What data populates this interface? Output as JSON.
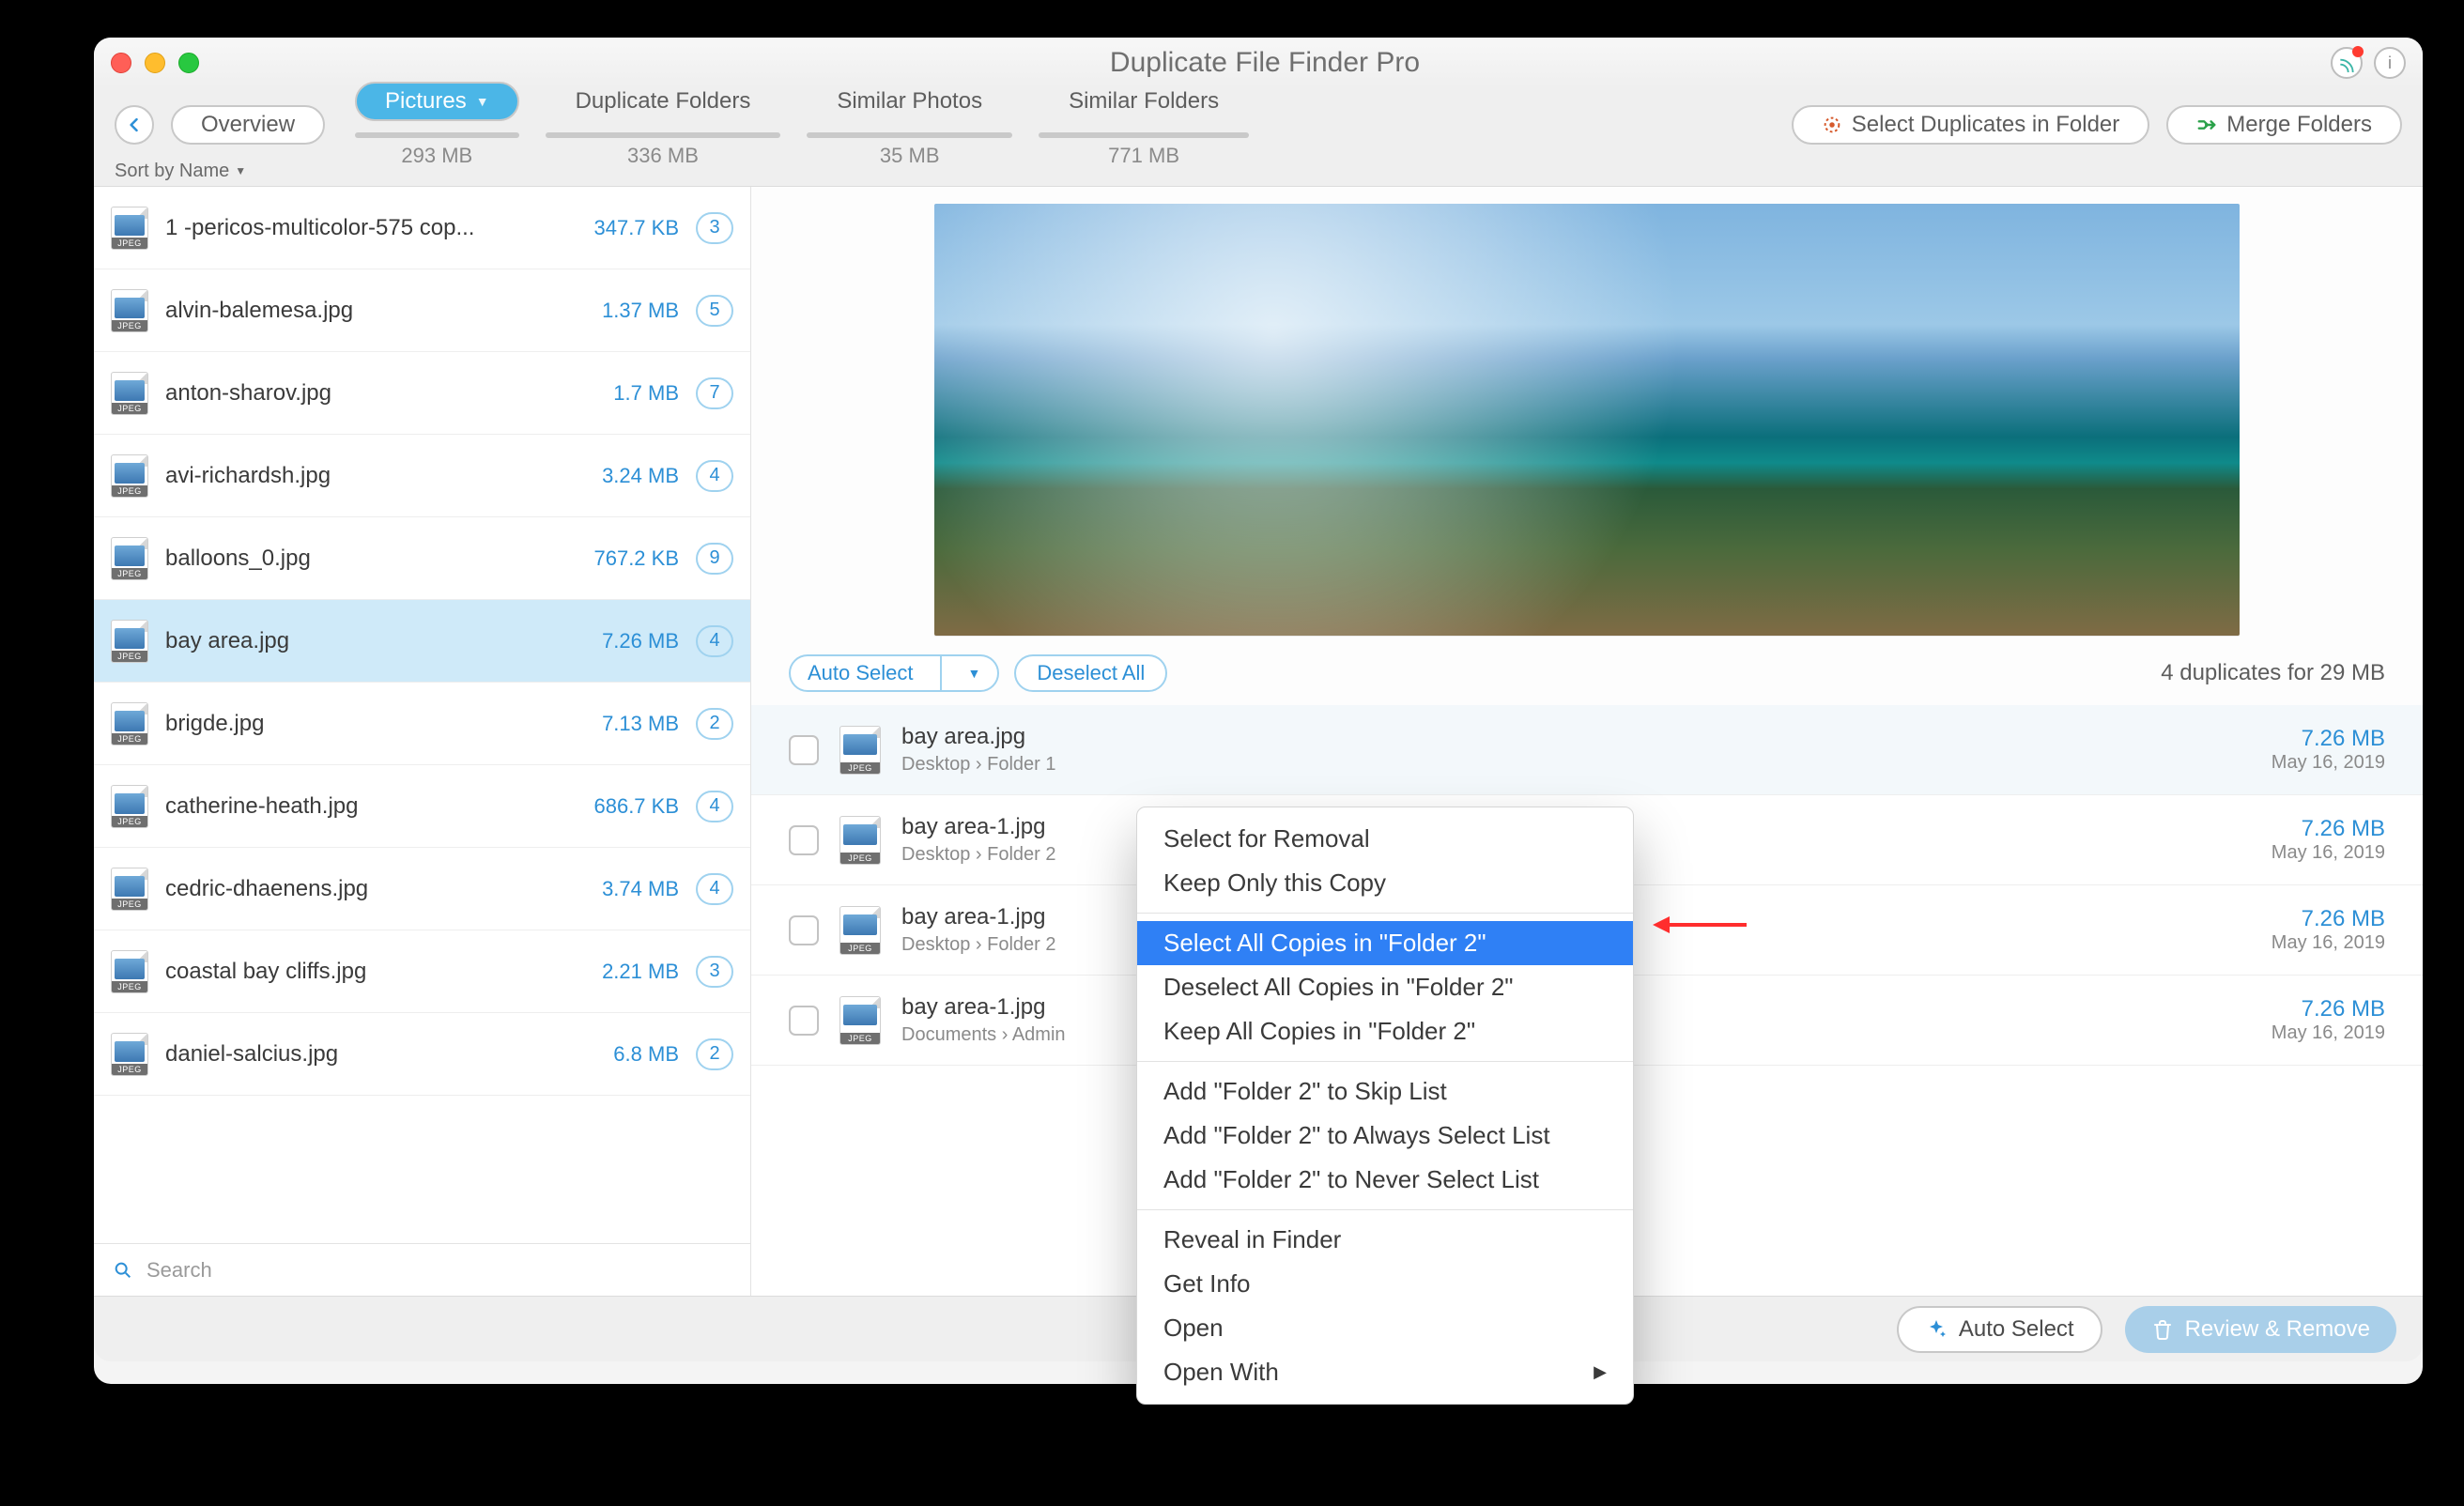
{
  "window": {
    "title": "Duplicate File Finder Pro"
  },
  "toolbar": {
    "overview": "Overview",
    "tabs": [
      {
        "label": "Pictures",
        "size": "293 MB",
        "active": true,
        "has_dropdown": true
      },
      {
        "label": "Duplicate Folders",
        "size": "336 MB"
      },
      {
        "label": "Similar Photos",
        "size": "35 MB"
      },
      {
        "label": "Similar Folders",
        "size": "771 MB"
      }
    ],
    "select_in_folder": "Select Duplicates in Folder",
    "merge_folders": "Merge Folders"
  },
  "sort": {
    "label": "Sort by Name"
  },
  "files": [
    {
      "name": "1 -pericos-multicolor-575 cop...",
      "size": "347.7 KB",
      "count": 3
    },
    {
      "name": "alvin-balemesa.jpg",
      "size": "1.37 MB",
      "count": 5
    },
    {
      "name": "anton-sharov.jpg",
      "size": "1.7 MB",
      "count": 7
    },
    {
      "name": "avi-richardsh.jpg",
      "size": "3.24 MB",
      "count": 4
    },
    {
      "name": "balloons_0.jpg",
      "size": "767.2 KB",
      "count": 9
    },
    {
      "name": "bay area.jpg",
      "size": "7.26 MB",
      "count": 4,
      "selected": true
    },
    {
      "name": "brigde.jpg",
      "size": "7.13 MB",
      "count": 2
    },
    {
      "name": "catherine-heath.jpg",
      "size": "686.7 KB",
      "count": 4
    },
    {
      "name": "cedric-dhaenens.jpg",
      "size": "3.74 MB",
      "count": 4
    },
    {
      "name": "coastal bay cliffs.jpg",
      "size": "2.21 MB",
      "count": 3
    },
    {
      "name": "daniel-salcius.jpg",
      "size": "6.8 MB",
      "count": 2
    }
  ],
  "search": {
    "placeholder": "Search"
  },
  "preview_toolbar": {
    "auto_select": "Auto Select",
    "deselect_all": "Deselect All",
    "summary": "4 duplicates for 29 MB"
  },
  "duplicates": [
    {
      "name": "bay area.jpg",
      "path": "Desktop  ›  Folder 1",
      "size": "7.26 MB",
      "date": "May 16, 2019",
      "first": true
    },
    {
      "name": "bay area-1.jpg",
      "path": "Desktop  ›  Folder 2",
      "size": "7.26 MB",
      "date": "May 16, 2019"
    },
    {
      "name": "bay area-1.jpg",
      "path": "Desktop  ›  Folder 2",
      "size": "7.26 MB",
      "date": "May 16, 2019"
    },
    {
      "name": "bay area-1.jpg",
      "path": "Documents  ›  Admin",
      "size": "7.26 MB",
      "date": "May 16, 2019"
    }
  ],
  "context_menu": {
    "items": [
      {
        "label": "Select for Removal"
      },
      {
        "label": "Keep Only this Copy"
      },
      {
        "sep": true
      },
      {
        "label": "Select All Copies in \"Folder 2\"",
        "highlight": true
      },
      {
        "label": "Deselect All Copies in \"Folder 2\""
      },
      {
        "label": "Keep All Copies in \"Folder 2\""
      },
      {
        "sep": true
      },
      {
        "label": "Add \"Folder 2\" to Skip List"
      },
      {
        "label": "Add \"Folder 2\" to Always Select List"
      },
      {
        "label": "Add \"Folder 2\" to Never Select List"
      },
      {
        "sep": true
      },
      {
        "label": "Reveal in Finder"
      },
      {
        "label": "Get Info"
      },
      {
        "label": "Open"
      },
      {
        "label": "Open With",
        "submenu": true
      }
    ]
  },
  "footer": {
    "auto_select": "Auto Select",
    "review_remove": "Review & Remove"
  },
  "icons": {
    "jpeg_tag": "JPEG"
  }
}
